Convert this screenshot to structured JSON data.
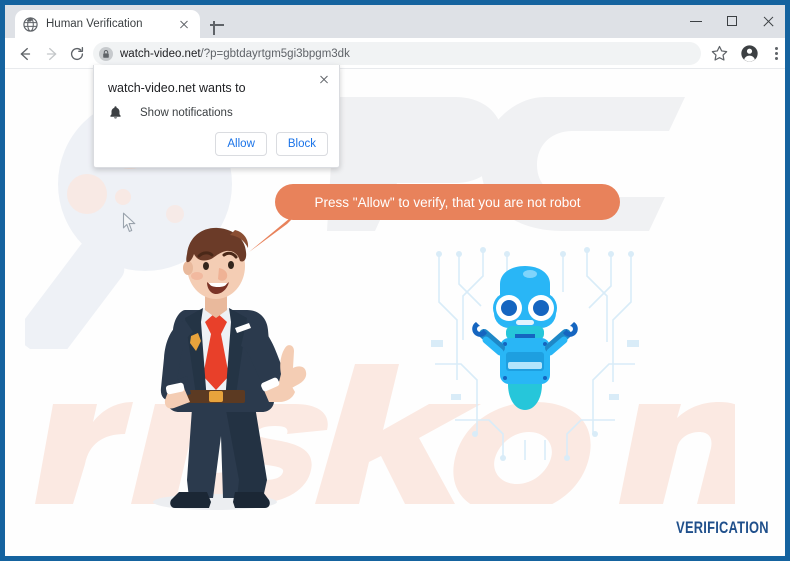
{
  "window": {
    "controls": {
      "minimize": "minimize-button",
      "maximize": "maximize-button",
      "close": "close-button"
    }
  },
  "tab": {
    "title": "Human Verification",
    "favicon": "globe-icon",
    "close_label": "close-tab-icon",
    "new_tab_label": "new-tab-icon"
  },
  "toolbar": {
    "back": "back-arrow-icon",
    "forward": "forward-arrow-icon",
    "reload": "reload-icon",
    "lock": "lock-icon",
    "url_domain": "watch-video.net",
    "url_path": "/?p=gbtdayrtgm5gi3bpgm3dk",
    "bookmark": "star-icon",
    "profile": "account-avatar-icon",
    "menu": "three-dot-menu-icon"
  },
  "notification_popup": {
    "title": "watch-video.net wants to",
    "permission_icon": "bell-icon",
    "permission_label": "Show notifications",
    "allow_label": "Allow",
    "block_label": "Block",
    "close_label": "close-popup-icon"
  },
  "page": {
    "speech_bubble_text": "Press \"Allow\" to verify, that you are not robot",
    "verification_label": "VERIFICATION",
    "businessman_alt": "businessman-pointing-illustration",
    "robot_alt": "blue-robot-illustration",
    "watermark_pc": "PC",
    "watermark_site": "risk.com"
  },
  "colors": {
    "window_border": "#15639f",
    "titlebar": "#dee1e6",
    "omnibox": "#f1f3f4",
    "bubble_orange": "#e8825b",
    "link_blue": "#1a73e8",
    "verification_navy": "#1f4f8b",
    "robot_cyan": "#29b6f6",
    "suit_navy": "#2c3e50",
    "tie_red": "#e8402a"
  }
}
